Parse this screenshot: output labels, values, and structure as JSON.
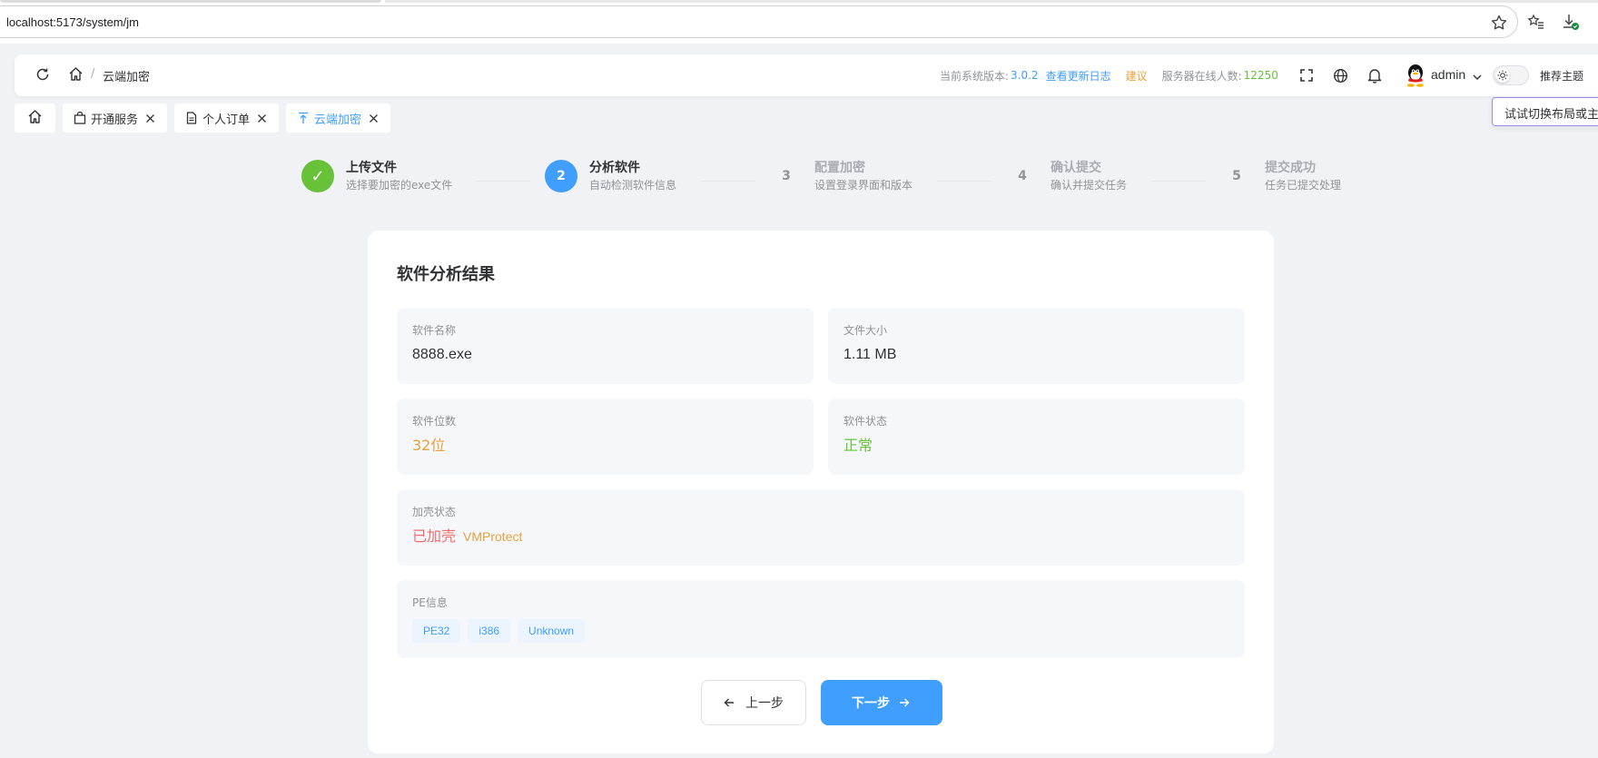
{
  "browser": {
    "url": "localhost:5173/system/jm"
  },
  "header": {
    "breadcrumb_current": "云端加密",
    "breadcrumb_separator": "/",
    "version_label": "当前系统版本:",
    "version_value": "3.0.2",
    "changelog_link": "查看更新日志",
    "suggestion_link": "建议",
    "online_label": "服务器在线人数:",
    "online_count": "12250",
    "user_name": "admin",
    "recommend_theme": "推荐主题",
    "tooltip_text": "试试切换布局或主"
  },
  "tabs": [
    {
      "label": "开通服务",
      "icon": "shopping-bag-icon"
    },
    {
      "label": "个人订单",
      "icon": "document-icon"
    },
    {
      "label": "云端加密",
      "icon": "upload-icon",
      "active": true
    }
  ],
  "steps": [
    {
      "number": "✓",
      "title": "上传文件",
      "desc": "选择要加密的exe文件",
      "status": "done"
    },
    {
      "number": "2",
      "title": "分析软件",
      "desc": "自动检测软件信息",
      "status": "active"
    },
    {
      "number": "3",
      "title": "配置加密",
      "desc": "设置登录界面和版本",
      "status": "wait"
    },
    {
      "number": "4",
      "title": "确认提交",
      "desc": "确认并提交任务",
      "status": "wait"
    },
    {
      "number": "5",
      "title": "提交成功",
      "desc": "任务已提交处理",
      "status": "wait"
    }
  ],
  "result": {
    "title": "软件分析结果",
    "name_label": "软件名称",
    "name_value": "8888.exe",
    "size_label": "文件大小",
    "size_value": "1.11 MB",
    "bits_label": "软件位数",
    "bits_value": "32位",
    "status_label": "软件状态",
    "status_value": "正常",
    "pack_label": "加壳状态",
    "pack_value": "已加壳",
    "pack_name": "VMProtect",
    "pe_label": "PE信息",
    "pe_tags": [
      "PE32",
      "i386",
      "Unknown"
    ]
  },
  "buttons": {
    "prev": "上一步",
    "next": "下一步"
  },
  "colors": {
    "primary": "#409eff",
    "success": "#67c23a",
    "warning": "#e6a23c",
    "danger": "#f56c6c"
  }
}
